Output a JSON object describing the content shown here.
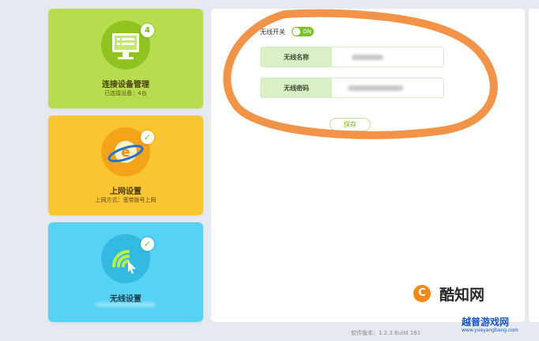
{
  "cards": {
    "devices": {
      "title": "连接设备管理",
      "subtitle": "已连接设备：4台",
      "badge": "4",
      "color": "#b7dc4e",
      "icon": "monitor-icon"
    },
    "internet": {
      "title": "上网设置",
      "subtitle": "上网方式：宽带拨号上网",
      "badge": "✓",
      "color": "#fbc432",
      "icon": "globe-icon"
    },
    "wireless": {
      "title": "无线设置",
      "badge": "✓",
      "color": "#56d2f4",
      "icon": "wifi-icon"
    }
  },
  "wireless": {
    "toggle_label": "无线开关",
    "toggle_state": "ON",
    "ssid_label": "无线名称",
    "password_label": "无线密码",
    "save_label": "保存"
  },
  "footer": {
    "version": "软件版本：1.2.3 Build 161"
  },
  "watermarks": {
    "primary": "酷知网",
    "secondary": "越普游戏网",
    "url": "www.yueyangbang.com"
  },
  "colors": {
    "accent": "#7cc12a",
    "annotation": "#f08a3a"
  }
}
